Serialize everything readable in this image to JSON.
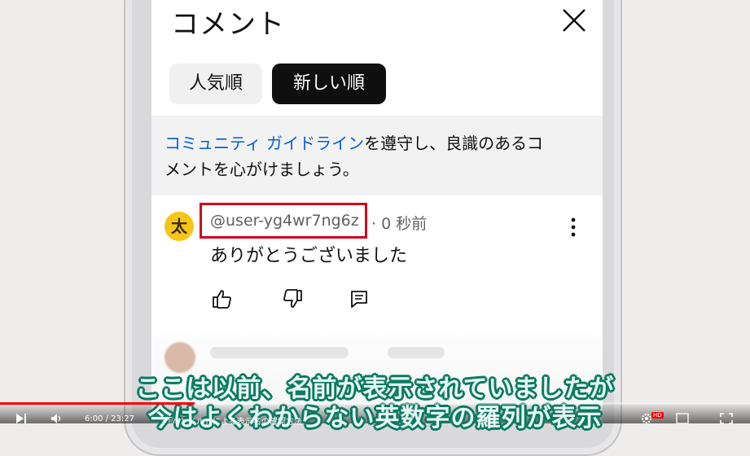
{
  "panel": {
    "title": "コメント",
    "close_icon": "close-icon"
  },
  "tabs": [
    {
      "label": "人気順",
      "selected": false
    },
    {
      "label": "新しい順",
      "selected": true
    }
  ],
  "guideline": {
    "link_text": "コミュニティ ガイドライン",
    "text_line1_rest": "を遵守し、良識のあるコ",
    "text_line2": "メントを心がけましょう。"
  },
  "comment": {
    "avatar_char": "太",
    "handle": "@user-yg4wr7ng6z",
    "time": "· 0 秒前",
    "text": "ありがとうございました",
    "actions": [
      "like-icon",
      "dislike-icon",
      "reply-icon"
    ],
    "menu_icon": "more-vert-icon"
  },
  "caption": {
    "line1": "ここは以前、名前が表示されていましたが",
    "line2": "今はよくわからない英数字の羅列が表示"
  },
  "player": {
    "progress": 0.26,
    "time": "6:00 / 23:27",
    "chapter": "・「ハンドル」による表示名の確認方法",
    "hd_badge": "HD",
    "accent": "#ff0000"
  }
}
